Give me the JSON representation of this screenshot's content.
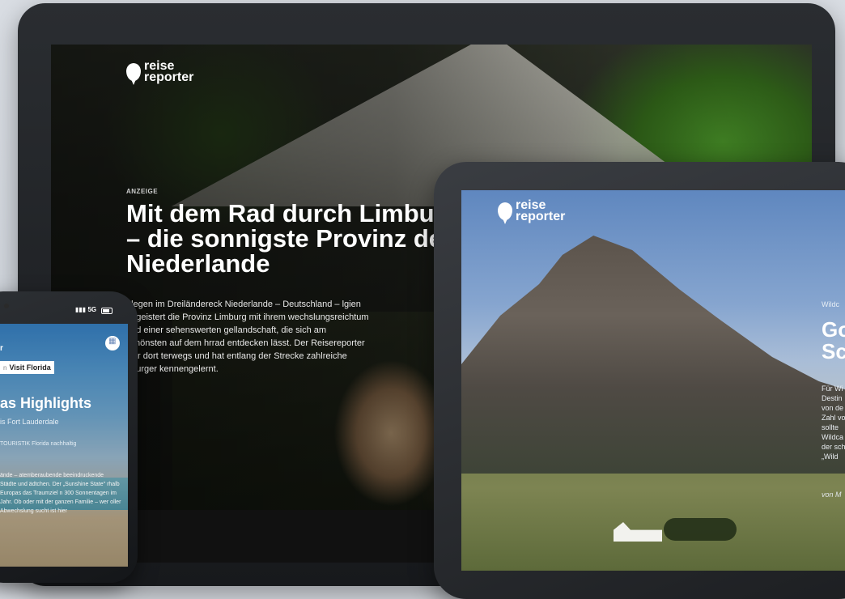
{
  "laptop": {
    "logo_line1": "reise",
    "logo_line2": "reporter",
    "kicker": "ANZEIGE",
    "title": "Mit dem Rad durch Limburg – die sonnigste Provinz der Niederlande",
    "body": "elegen im Dreiländereck Niederlande – Deutschland – lgien begeistert die Provinz Limburg mit ihrem wechslungsreichtum und einer sehenswerten gellandschaft, die sich am schönsten auf dem hrrad entdecken lässt. Der Reisereporter war dort terwegs und hat entlang der Strecke zahlreiche nburger kennengelernt."
  },
  "tablet": {
    "logo_line1": "reise",
    "logo_line2": "reporter",
    "kicker_fragment": "Wildc",
    "title_fragment": "Go Sc",
    "body_fragment": "Für Wi Destin von de Zahl vo sollte Wildca der sch „Wild",
    "author_fragment": "von M"
  },
  "phone": {
    "status_signal": "5G",
    "logo_fragment": "r",
    "badge_prefix": "n",
    "badge_label": "Visit Florida",
    "title_fragment": "as Highlights",
    "subtitle_fragment": "is Fort Lauderdale",
    "credit_fragment": "TOURISTIK Florida nachhaltig",
    "body_fragment": "ände – atemberaubende beeindruckende Städte und ädtchen. Der „Sunshine State\" rhalb Europas das Traumziel n 300 Sonnentagen im Jahr. Ob oder mit der ganzen Familie – wer oller Abwechslung sucht ist hier"
  }
}
